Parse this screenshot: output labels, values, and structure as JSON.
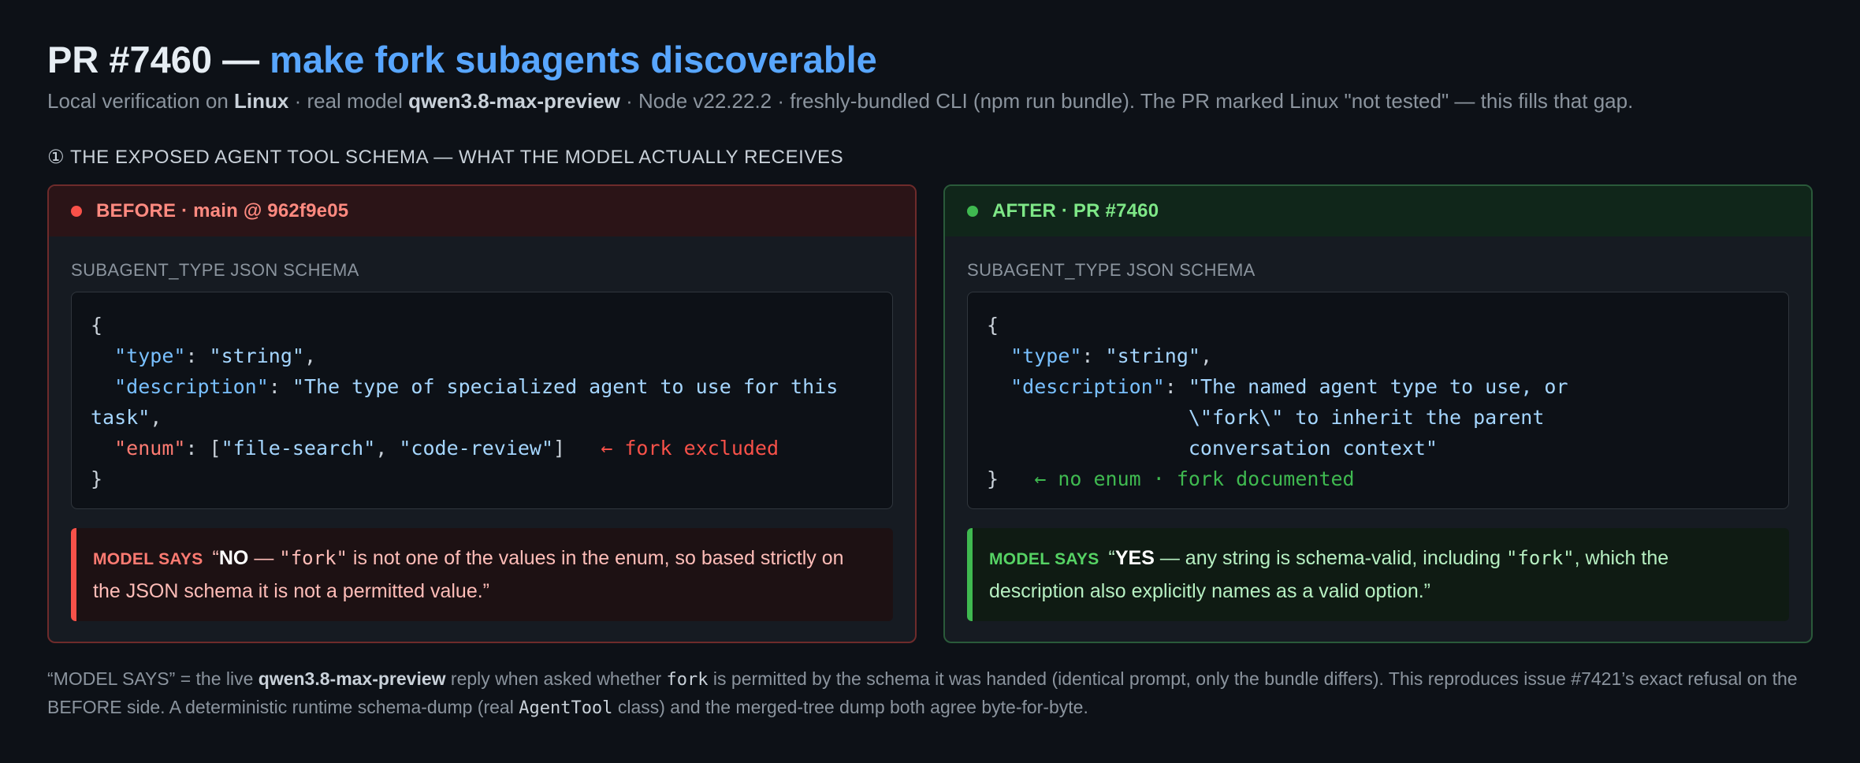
{
  "header": {
    "title_prefix": "PR #7460 — ",
    "title_accent": "make fork subagents discoverable",
    "subtitle": {
      "part1": "Local verification on ",
      "linux": "Linux",
      "part2": " · real model ",
      "model": "qwen3.8-max-preview",
      "part3": " · Node v22.22.2 · freshly-bundled CLI (npm run bundle). The PR marked Linux \"not tested\" — this fills that gap."
    }
  },
  "section": {
    "heading": "① THE EXPOSED AGENT TOOL SCHEMA — WHAT THE MODEL ACTUALLY RECEIVES"
  },
  "before": {
    "header": "BEFORE · main @ 962f9e05",
    "schema_label": "SUBAGENT_TYPE JSON SCHEMA",
    "code": {
      "open": "{",
      "type_key": "\"type\"",
      "type_val": "\"string\"",
      "desc_key": "\"description\"",
      "desc_val": "\"The type of specialized agent to use for this task\"",
      "enum_key": "\"enum\"",
      "enum_val1": "\"file-search\"",
      "enum_val2": "\"code-review\"",
      "enum_note": "← fork excluded",
      "close": "}"
    },
    "callout": {
      "tag": "MODEL SAYS",
      "quote_open": "“",
      "bold": "NO",
      "dash": " — ",
      "code": "\"fork\"",
      "text": " is not one of the values in the enum, so based strictly on the JSON schema it is not a permitted value.”"
    }
  },
  "after": {
    "header": "AFTER · PR #7460",
    "schema_label": "SUBAGENT_TYPE JSON SCHEMA",
    "code": {
      "open": "{",
      "type_key": "\"type\"",
      "type_val": "\"string\"",
      "desc_key": "\"description\"",
      "desc_line1": "\"The named agent type to use, or",
      "desc_line2": "\\\"fork\\\" to inherit the parent",
      "desc_line3": "conversation context\"",
      "close": "}",
      "note": "← no enum · fork documented"
    },
    "callout": {
      "tag": "MODEL SAYS",
      "quote_open": "“",
      "bold": "YES",
      "text1": " — any string is schema-valid, including ",
      "code": "\"fork\"",
      "text2": ", which the description also explicitly names as a valid option.”"
    }
  },
  "footer": {
    "part1": "“MODEL SAYS” = the live ",
    "model": "qwen3.8-max-preview",
    "part2": " reply when asked whether ",
    "code1": "fork",
    "part3": " is permitted by the schema it was handed (identical prompt, only the bundle differs). This reproduces issue #7421’s exact refusal on the BEFORE side. A deterministic runtime schema-dump (real ",
    "code2": "AgentTool",
    "part4": " class) and the merged-tree dump both agree byte-for-byte."
  }
}
